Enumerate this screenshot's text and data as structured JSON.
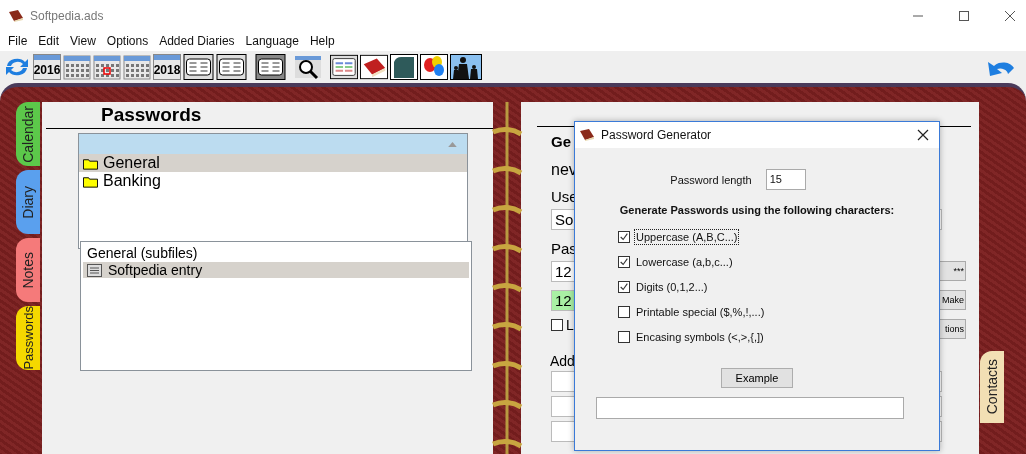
{
  "window": {
    "title": "Softpedia.ads"
  },
  "menu": [
    "File",
    "Edit",
    "View",
    "Options",
    "Added Diaries",
    "Language",
    "Help"
  ],
  "toolbar": [
    {
      "kind": "refresh"
    },
    {
      "kind": "year",
      "label": "2016"
    },
    {
      "kind": "calendar"
    },
    {
      "kind": "today"
    },
    {
      "kind": "calendar"
    },
    {
      "kind": "year",
      "label": "2018"
    },
    {
      "kind": "layout",
      "selected": false
    },
    {
      "kind": "layout",
      "selected": false
    },
    {
      "kind": "layout",
      "selected": true
    },
    {
      "kind": "zoom"
    },
    {
      "kind": "list"
    },
    {
      "kind": "book"
    },
    {
      "kind": "texture"
    },
    {
      "kind": "balloons"
    },
    {
      "kind": "family"
    }
  ],
  "side_tabs": [
    {
      "label": "Calendar",
      "color": "#5cc84a"
    },
    {
      "label": "Diary",
      "color": "#5aa0ee"
    },
    {
      "label": "Notes",
      "color": "#f57a7a"
    },
    {
      "label": "Passwords",
      "color": "#f5d800"
    }
  ],
  "left_page": {
    "title": "Passwords",
    "folders": [
      {
        "label": "General",
        "selected": true
      },
      {
        "label": "Banking",
        "selected": false
      }
    ],
    "files": {
      "header": "General (subfiles)",
      "items": [
        {
          "label": "Softpedia entry",
          "selected": true
        }
      ]
    }
  },
  "right_page": {
    "heading": "Ge",
    "name": "nev",
    "user_label": "Use",
    "user_value": "So",
    "password_label": "Pas",
    "password_value": "12",
    "password_check": "12",
    "option": {
      "label": "L",
      "checked": false
    },
    "buttons": [
      "***",
      "Make",
      "tions"
    ],
    "additional_label": "Add"
  },
  "right_tabs": [
    {
      "label": "Contacts",
      "color": "#f2dfb4"
    }
  ],
  "dialog": {
    "title": "Password Generator",
    "length_label": "Password length",
    "length_value": "15",
    "heading": "Generate Passwords using the following characters:",
    "options": [
      {
        "label": "Uppercase (A,B,C...)",
        "checked": true,
        "focused": true
      },
      {
        "label": "Lowercase (a,b,c...)",
        "checked": true,
        "focused": false
      },
      {
        "label": "Digits (0,1,2...)",
        "checked": true,
        "focused": false
      },
      {
        "label": "Printable special ($,%,!,...)",
        "checked": false,
        "focused": false
      },
      {
        "label": "Encasing symbols (<,>,{,])",
        "checked": false,
        "focused": false
      }
    ],
    "example_button": "Example"
  }
}
